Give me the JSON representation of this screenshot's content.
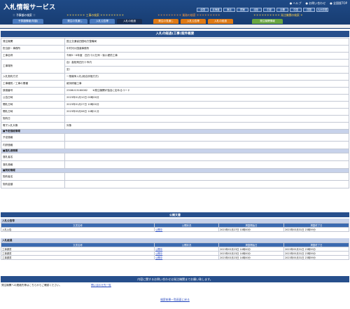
{
  "header": {
    "title": "入札情報サービス",
    "links": [
      "● ヘルプ",
      "● お問い合わせ",
      "● 全国版TOP"
    ],
    "regions": [
      "全国",
      "北海道",
      "東北",
      "関東",
      "北陸",
      "中部",
      "近畿",
      "中国",
      "四国",
      "九州沖縄"
    ],
    "groups": [
      "＝ 予算額の検索 ＝",
      "＊＊＊＊＊＊＊ 工事の検索 ＊＊＊＊＊＊＊＊＊",
      "＊＊＊＊＊＊＊＊＊ 業務の検索 ＊＊＊＊＊＊＊＊＊",
      "＊＊＊＊＊＊＊＊＊＊ 発注機関の検索 ＊"
    ],
    "tabs": [
      "予算額情報(年額)",
      "発注の見通し",
      "入札公告等",
      "入札の経過",
      "発注の見通し",
      "入札公告等",
      "入札の経過",
      "発注機関情報"
    ]
  },
  "case": {
    "heading": "入札の経過(工事)案件概要",
    "rows": [
      {
        "label": "発注機関",
        "value": "国土交通省四国地方整備局"
      },
      {
        "label": "担当部・事務所",
        "value": "中村河川国道事務所"
      },
      {
        "label": "工事名称",
        "value": "令和5－6年度　四万十川左岸・後川堤防工事"
      },
      {
        "label": "工事場所",
        "value": "自）高知県四万十市内"
      },
      {
        "label": "",
        "value": "至）"
      },
      {
        "label": "入札契約方式",
        "value": "一般競争入札(総合評価方式)"
      },
      {
        "label": "工事種別／工事の業種",
        "value": "維持修繕工事"
      },
      {
        "label": "調達番号",
        "value": "2306U13160082　　※発注機関が独自に定めるコード"
      },
      {
        "label": "公告日時",
        "value": "2023年01月10日 00時00分"
      },
      {
        "label": "開札日時",
        "value": "2023年01月27日 10時00分"
      },
      {
        "label": "開札日時",
        "value": "2023年03月06日 14時11分"
      },
      {
        "label": "契約日",
        "value": ""
      },
      {
        "label": "電子入札対象",
        "value": "対象"
      }
    ],
    "sections": [
      {
        "title": "■予定価格情報",
        "rows": [
          "予定価格",
          "内訳価格"
        ]
      },
      {
        "title": "■落札者情報",
        "rows": [
          "落札者名",
          "落札価格"
        ]
      },
      {
        "title": "■契約情報",
        "rows": [
          "契約者名",
          "契約金額"
        ]
      }
    ]
  },
  "docs": {
    "heading": "公開文書",
    "columns": [
      "文書名称",
      "公開状況",
      "掲載開始日",
      "掲載終了日"
    ],
    "koukoku": {
      "title": "入札公告等",
      "rows": [
        {
          "name": "入札公告",
          "status": "公開中",
          "start": "2023年01月27日 10時00分",
          "end": "2023年03月31日 23時59分"
        }
      ]
    },
    "keika": {
      "title": "入札経過",
      "rows": [
        {
          "name": "工事調書",
          "status": "公開中",
          "start": "2023年03月23日 14時00分",
          "end": "2023年05月31日 23時59分"
        },
        {
          "name": "工事調書",
          "status": "公開中",
          "start": "2023年03月23日 14時00分",
          "end": "2023年05月31日 23時59分"
        },
        {
          "name": "工事調書",
          "status": "公開中",
          "start": "2023年03月23日 14時00分",
          "end": "2023年05月31日 23時59分"
        }
      ]
    }
  },
  "footer": {
    "contact_bar": "内容に関するお問い合わせは発注機関までお願い致します。",
    "contact_text": "発注機関への連絡先等はこちらからご確認ください。",
    "contact_link": "問い合わせ先一覧",
    "back_link": "検索結果一覧画面に戻る"
  }
}
